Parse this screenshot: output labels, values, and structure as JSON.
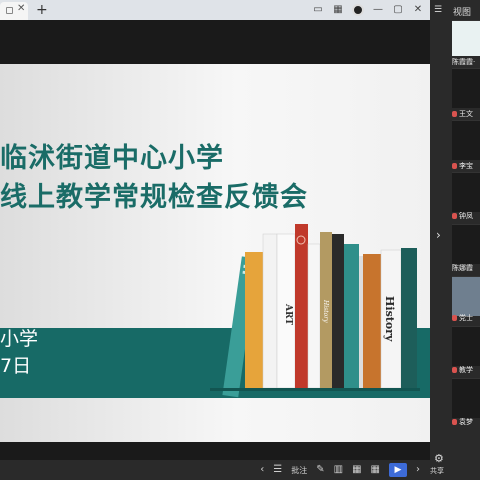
{
  "browser": {
    "newtab_symbol": "+"
  },
  "slide": {
    "title_line1": "临沭街道中心小学",
    "title_line2": "线上教学常规检查反馈会",
    "school_fragment": "小学",
    "date_fragment": "7日",
    "book_labels": [
      "ART",
      "History",
      "History"
    ]
  },
  "sidebar": {
    "view_label": "视图",
    "expand_arrow": "›",
    "participants": [
      "陈霞霞·",
      "王文",
      "李宝",
      "钟凤",
      "陈娜霞",
      "党士",
      "教学",
      "袁梦"
    ],
    "bottom_label": "共享"
  },
  "toolbar": {
    "prev": "‹",
    "list": "☰",
    "note_label": "批注",
    "next": "›",
    "play": "▶"
  },
  "colors": {
    "accent_teal": "#176a66",
    "play_blue": "#3d6bd8"
  }
}
